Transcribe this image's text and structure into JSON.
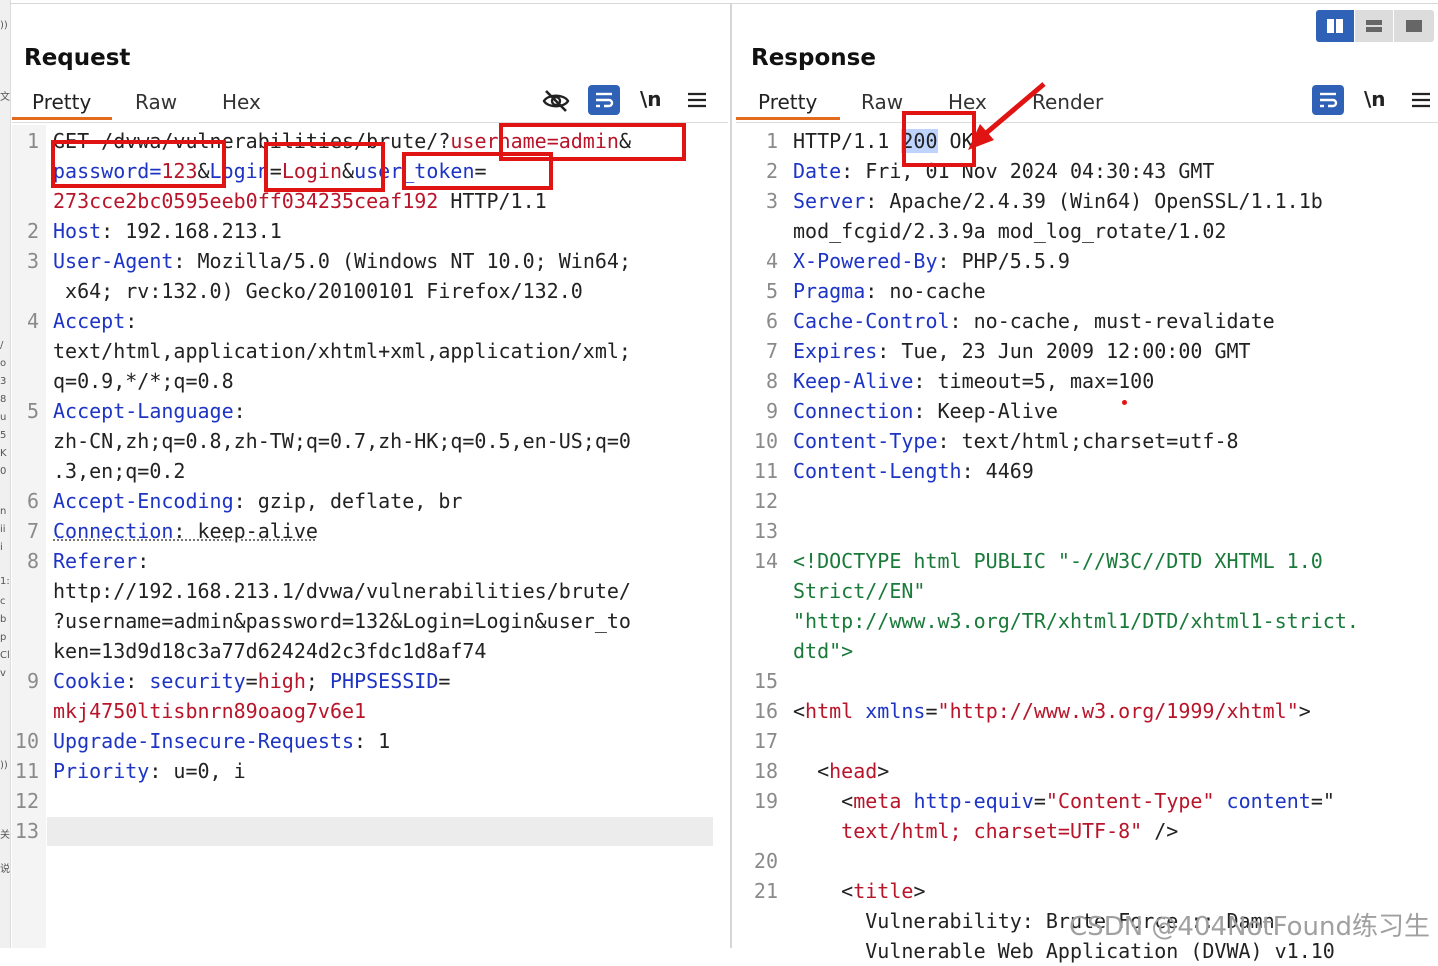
{
  "left_strip_chars": [
    "))",
    "文",
    "/",
    "o",
    "3",
    "8",
    "u",
    "5",
    "K",
    "0",
    "n",
    "ii",
    "i",
    "1:",
    "c",
    "b",
    "p",
    "Cl",
    "v",
    "))",
    "关",
    "说"
  ],
  "request": {
    "title": "Request",
    "tabs": [
      "Pretty",
      "Raw",
      "Hex"
    ],
    "active_tab": "Pretty",
    "icons": [
      "eye-slash-icon",
      "wrap-lines-icon",
      "newline-icon",
      "menu-icon"
    ],
    "newline_label": "\\n",
    "line_numbers": [
      "1",
      "2",
      "3",
      "4",
      "5",
      "6",
      "7",
      "8",
      "9",
      "10",
      "11",
      "12",
      "13"
    ],
    "lines": [
      [
        "GET /dvwa/vulnerabilities/brute/?",
        "username=admin",
        "&"
      ],
      [
        "password=",
        "123",
        "&",
        "Login",
        "=",
        "Login",
        "&",
        "user_token",
        "="
      ],
      [
        "273cce2bc0595eeb0ff034235ceaf192",
        " HTTP/1.1"
      ],
      [
        "Host",
        ": 192.168.213.1"
      ],
      [
        "User-Agent",
        ": Mozilla/5.0 (Windows NT 10.0; Win64;"
      ],
      [
        " x64; rv:132.0) Gecko/20100101 Firefox/132.0"
      ],
      [
        "Accept",
        ":"
      ],
      [
        "text/html,application/xhtml+xml,application/xml;"
      ],
      [
        "q=0.9,*/*;q=0.8"
      ],
      [
        "Accept-Language",
        ":"
      ],
      [
        "zh-CN,zh;q=0.8,zh-TW;q=0.7,zh-HK;q=0.5,en-US;q=0"
      ],
      [
        ".3,en;q=0.2"
      ],
      [
        "Accept-Encoding",
        ": gzip, deflate, br"
      ],
      [
        "Connection",
        ": keep-alive"
      ],
      [
        "Referer",
        ":"
      ],
      [
        "http://192.168.213.1/dvwa/vulnerabilities/brute/"
      ],
      [
        "?username=admin&password=132&Login=Login&user_to"
      ],
      [
        "ken=13d9d18c3a77d62424d2c3fdc1d8af74"
      ],
      [
        "Cookie",
        ": ",
        "security",
        "=",
        "high",
        "; ",
        "PHPSESSID",
        "="
      ],
      [
        "mkj4750ltisbnrn89oaog7v6e1"
      ],
      [
        "Upgrade-Insecure-Requests",
        ": 1"
      ],
      [
        "Priority",
        ": u=0, i"
      ]
    ]
  },
  "response": {
    "title": "Response",
    "tabs": [
      "Pretty",
      "Raw",
      "Hex",
      "Render"
    ],
    "active_tab": "Pretty",
    "icons": [
      "wrap-lines-icon",
      "newline-icon",
      "menu-icon"
    ],
    "newline_label": "\\n",
    "view_toggle": [
      "split-columns-icon",
      "split-rows-icon",
      "single-pane-icon"
    ],
    "line_numbers": [
      "1",
      "2",
      "3",
      "4",
      "5",
      "6",
      "7",
      "8",
      "9",
      "10",
      "11",
      "12",
      "13",
      "14",
      "15",
      "16",
      "17",
      "18",
      "19",
      "20",
      "21"
    ],
    "lines": [
      [
        "HTTP/1.1 ",
        "200",
        " OK"
      ],
      [
        "Date",
        ": Fri, 01 Nov 2024 04:30:43 GMT"
      ],
      [
        "Server",
        ": Apache/2.4.39 (Win64) OpenSSL/1.1.1b"
      ],
      [
        "mod_fcgid/2.3.9a mod_log_rotate/1.02"
      ],
      [
        "X-Powered-By",
        ": PHP/5.5.9"
      ],
      [
        "Pragma",
        ": no-cache"
      ],
      [
        "Cache-Control",
        ": no-cache, must-revalidate"
      ],
      [
        "Expires",
        ": Tue, 23 Jun 2009 12:00:00 GMT"
      ],
      [
        "Keep-Alive",
        ": timeout=5, max=100"
      ],
      [
        "Connection",
        ": Keep-Alive"
      ],
      [
        "Content-Type",
        ": text/html;charset=utf-8"
      ],
      [
        "Content-Length",
        ": 4469"
      ],
      [
        "<!DOCTYPE html PUBLIC \"-//W3C//DTD XHTML 1.0"
      ],
      [
        "Strict//EN\""
      ],
      [
        "\"http://www.w3.org/TR/xhtml1/DTD/xhtml1-strict."
      ],
      [
        "dtd\">"
      ],
      [
        "<",
        "html",
        " ",
        "xmlns",
        "=",
        "\"http://www.w3.org/1999/xhtml\"",
        ">"
      ],
      [
        "  <",
        "head",
        ">"
      ],
      [
        "    <",
        "meta",
        " ",
        "http-equiv",
        "=",
        "\"Content-Type\"",
        " ",
        "content",
        "=\""
      ],
      [
        "    text/html; charset=UTF-8\"",
        " />"
      ],
      [
        "    <",
        "title",
        ">"
      ],
      [
        "      Vulnerability: Brute Force :: Damn"
      ],
      [
        "      Vulnerable Web Application (DVWA) v1.10"
      ]
    ]
  },
  "watermark": "CSDN @404NotFound练习生"
}
